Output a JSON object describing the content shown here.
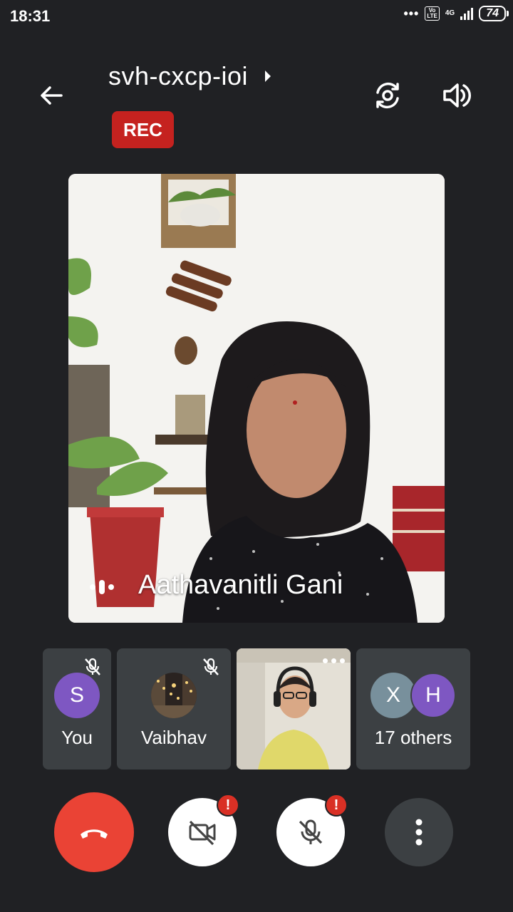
{
  "status_bar": {
    "time": "18:31",
    "signal_dots": "•••",
    "volte_line1": "Vo",
    "volte_line2": "LTE",
    "network": "4G",
    "battery": "74"
  },
  "header": {
    "meeting_code": "svh-cxcp-ioi",
    "rec_label": "REC",
    "icons": [
      "back-arrow-icon",
      "chevron-right-icon",
      "switch-camera-icon",
      "speaker-icon"
    ]
  },
  "main_video": {
    "speaker_name": "Aathavanitli Gani",
    "speaking": true
  },
  "participants": [
    {
      "avatar_letter": "S",
      "label": "You",
      "muted": true,
      "avatar_color": "#7e57c2"
    },
    {
      "avatar_letter": "",
      "label": "Vaibhav",
      "muted": true
    },
    {
      "label": "",
      "video_on": true
    },
    {
      "avatars": [
        "X",
        "H"
      ],
      "label": "17 others",
      "avatar_colors": [
        "#78909c",
        "#7e57c2"
      ]
    }
  ],
  "controls": {
    "end_call_color": "#ea4335",
    "alert_mark": "!",
    "icons": [
      "end-call-icon",
      "camera-off-icon",
      "mic-off-icon",
      "more-vert-icon"
    ]
  }
}
